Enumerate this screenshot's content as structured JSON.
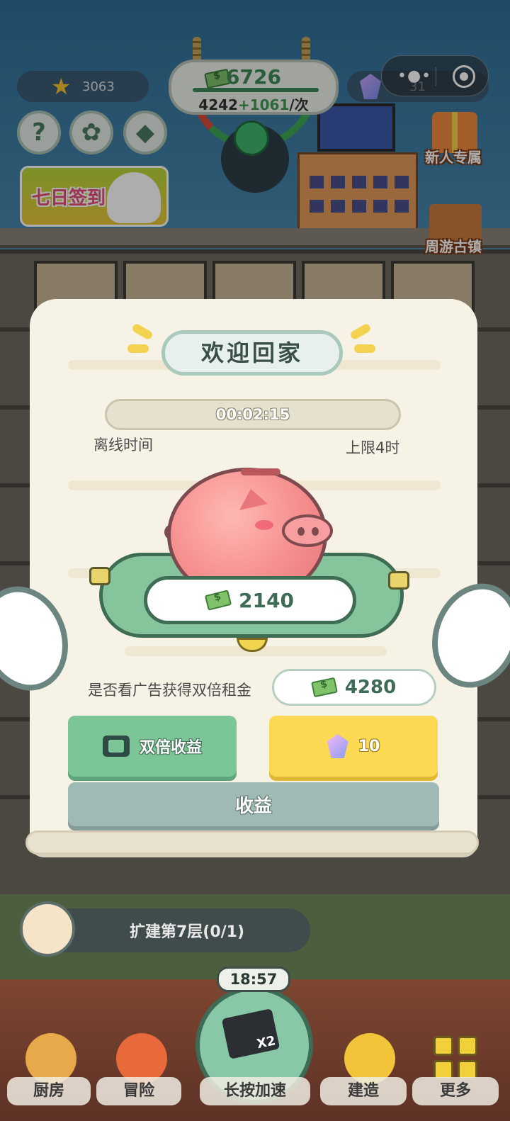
{
  "hud": {
    "stars": "3063",
    "money": "6726",
    "income_base": "4242",
    "income_bonus": "+1061",
    "income_unit": "/次",
    "gems": "31"
  },
  "side": {
    "new_player_label": "新人专属",
    "town_label": "周游古镇",
    "signin_label": "七日签到",
    "help_glyph": "?"
  },
  "dialog": {
    "title": "欢迎回家",
    "offline_time": "00:02:15",
    "offline_label": "离线时间",
    "limit_label": "上限4时",
    "reward_amount": "2140",
    "ad_question": "是否看广告获得双倍租金",
    "double_amount": "4280",
    "double_button_label": "双倍收益",
    "gem_button_value": "10",
    "collect_button_label": "收益"
  },
  "bottom": {
    "expand_label": "扩建第7层(0/1)",
    "speed_timer": "18:57",
    "speed_badge": "X2",
    "nav": [
      "厨房",
      "冒险",
      "长按加速",
      "建造",
      "更多"
    ]
  },
  "icons": {
    "star": "star-icon",
    "cash": "cash-icon",
    "gem": "gem-icon",
    "video": "video-icon",
    "settings": "gear-icon",
    "help": "help-icon"
  },
  "colors": {
    "accent_green": "#3e8a57",
    "button_green": "#7cc596",
    "button_yellow": "#fbd953",
    "button_gray": "#9fbab4",
    "paper": "#f6f2e6"
  }
}
